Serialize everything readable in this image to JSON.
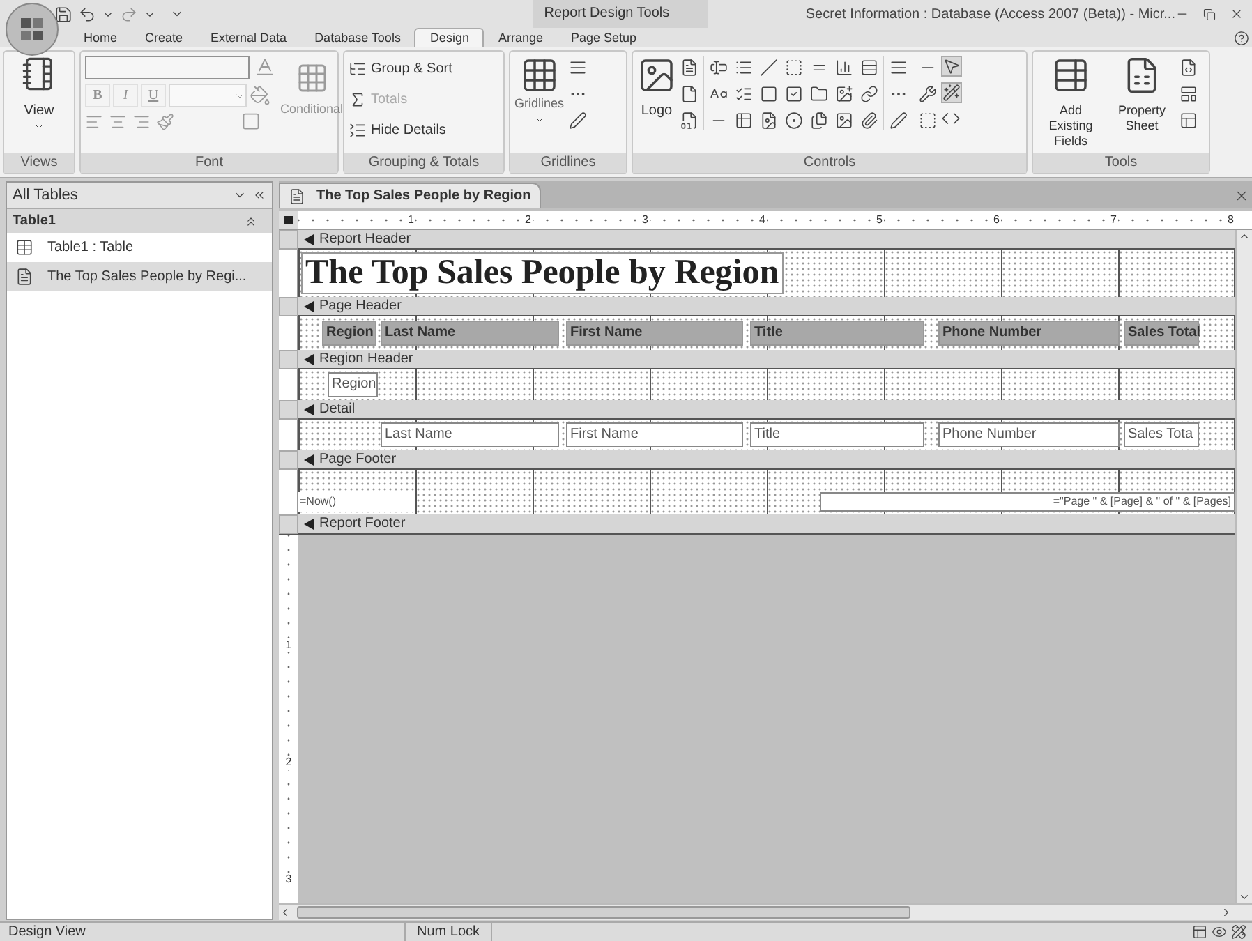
{
  "window": {
    "title": "Secret Information : Database (Access 2007 (Beta)) - Micr...",
    "tools_group": "Report Design Tools"
  },
  "ribbon_tabs": [
    {
      "label": "Home",
      "selected": false
    },
    {
      "label": "Create",
      "selected": false
    },
    {
      "label": "External Data",
      "selected": false
    },
    {
      "label": "Database Tools",
      "selected": false
    },
    {
      "label": "Design",
      "selected": true
    },
    {
      "label": "Arrange",
      "selected": false
    },
    {
      "label": "Page Setup",
      "selected": false
    }
  ],
  "ribbon": {
    "views": {
      "label": "Views",
      "button": "View"
    },
    "font": {
      "label": "Font",
      "disabled": true,
      "bold": "B",
      "italic": "I",
      "underline": "U",
      "conditional": "Conditional"
    },
    "grouping": {
      "label": "Grouping & Totals",
      "buttons": [
        {
          "label": "Group & Sort",
          "disabled": false
        },
        {
          "label": "Totals",
          "disabled": true
        },
        {
          "label": "Hide Details",
          "disabled": false
        }
      ]
    },
    "gridlines": {
      "label": "Gridlines",
      "button": "Gridlines"
    },
    "controls": {
      "label": "Controls",
      "logo": "Logo"
    },
    "tools": {
      "label": "Tools",
      "buttons": [
        "Add Existing Fields",
        "Property Sheet"
      ]
    }
  },
  "navigation": {
    "header": "All Tables",
    "groups": [
      {
        "label": "Table1",
        "expanded": true,
        "items": [
          {
            "label": "Table1 : Table",
            "kind": "table",
            "selected": false
          },
          {
            "label": "The Top Sales People by Regi...",
            "kind": "report",
            "selected": true
          }
        ]
      }
    ]
  },
  "document": {
    "tab": "The Top Sales People by Region",
    "ruler": [
      "1",
      "2",
      "3",
      "4",
      "5",
      "6",
      "7",
      "8"
    ],
    "vertical_ruler": [
      "1",
      "2",
      "3"
    ],
    "sections": [
      {
        "name": "Report Header",
        "kind": "report_header",
        "controls": [
          {
            "kind": "title",
            "text": "The Top Sales People by Region"
          }
        ]
      },
      {
        "name": "Page Header",
        "kind": "page_header",
        "controls": [
          {
            "kind": "label",
            "text": "Region"
          },
          {
            "kind": "label",
            "text": "Last Name"
          },
          {
            "kind": "label",
            "text": "First Name"
          },
          {
            "kind": "label",
            "text": "Title"
          },
          {
            "kind": "label",
            "text": "Phone Number"
          },
          {
            "kind": "label",
            "text": "Sales Total"
          }
        ]
      },
      {
        "name": "Region Header",
        "kind": "group_header",
        "controls": [
          {
            "kind": "textbox",
            "text": "Region"
          }
        ]
      },
      {
        "name": "Detail",
        "kind": "detail",
        "controls": [
          {
            "kind": "textbox",
            "text": "Last Name"
          },
          {
            "kind": "textbox",
            "text": "First Name"
          },
          {
            "kind": "textbox",
            "text": "Title"
          },
          {
            "kind": "textbox",
            "text": "Phone Number"
          },
          {
            "kind": "textbox",
            "text": "Sales Tota"
          }
        ]
      },
      {
        "name": "Page Footer",
        "kind": "page_footer",
        "controls": [
          {
            "kind": "expression",
            "text": "=Now()"
          },
          {
            "kind": "expression_right",
            "text": "=\"Page \" & [Page] & \" of \" & [Pages]"
          }
        ]
      },
      {
        "name": "Report Footer",
        "kind": "report_footer"
      }
    ]
  },
  "status_bar": {
    "mode": "Design View",
    "num_lock": "Num Lock"
  }
}
